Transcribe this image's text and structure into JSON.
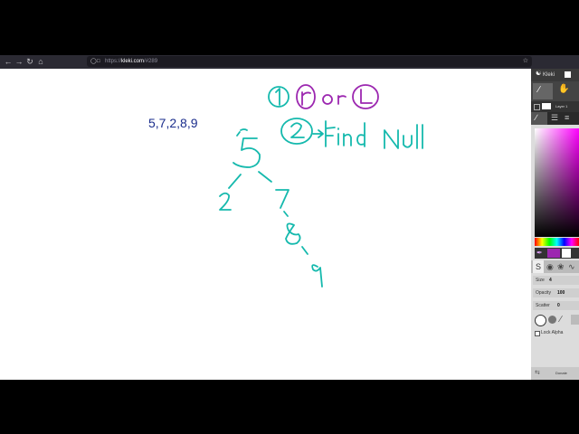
{
  "browser": {
    "url_prefix": "https://",
    "url_host": "kleki.com",
    "url_path": "/#289"
  },
  "canvas": {
    "sequence_text": "5,7,2,8,9",
    "colors": {
      "teal": "#15b9ad",
      "purple": "#9c27b0",
      "navy": "#1a2d8c"
    }
  },
  "panel": {
    "app_name": "Kleki",
    "layer_name": "Layer 1",
    "size_label": "Size",
    "size_value": "4",
    "opacity_label": "Opacity",
    "opacity_value": "100",
    "scatter_label": "Scatter",
    "scatter_value": "0",
    "lock_alpha_label": "Lock Alpha",
    "donate_label": "Donate",
    "selected_color": "#9c27b0"
  }
}
